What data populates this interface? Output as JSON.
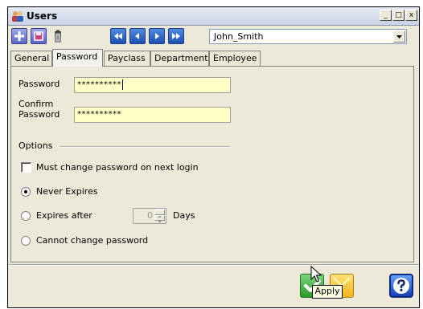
{
  "window": {
    "title": "Users",
    "minimize_label": "_",
    "maximize_label": "□",
    "close_label": "x"
  },
  "toolbar": {
    "icons": [
      "add-icon",
      "save-icon",
      "trash-icon",
      "first-record-icon",
      "previous-record-icon",
      "next-record-icon",
      "last-record-icon"
    ],
    "user_select_value": "John_Smith"
  },
  "tabs": [
    {
      "label": "General",
      "active": false
    },
    {
      "label": "Password",
      "active": true
    },
    {
      "label": "Payclass",
      "active": false
    },
    {
      "label": "Department",
      "active": false
    },
    {
      "label": "Employee",
      "active": false
    }
  ],
  "password_tab": {
    "password_label": "Password",
    "password_value": "**********",
    "confirm_label_line1": "Confirm",
    "confirm_label_line2": "Password",
    "confirm_value": "**********",
    "options_label": "Options",
    "must_change_label": "Must change password on next login",
    "must_change_checked": false,
    "never_expires_label": "Never Expires",
    "expires_after_label": "Expires after",
    "expires_after_value": "0",
    "days_label": "Days",
    "cannot_change_label": "Cannot change password",
    "selected_expiry_option": "Never Expires"
  },
  "footer": {
    "tooltip": "Apply",
    "ok_icon": "checkmark-icon",
    "cancel_icon": "cancel-icon",
    "help_icon": "question-mark-icon"
  },
  "colors": {
    "field_background": "#ffffc6",
    "window_background": "#ece9d8",
    "toolbar_blue": "#2a5ccc",
    "ok_green": "#2a9a2a",
    "help_blue": "#1740b8"
  }
}
